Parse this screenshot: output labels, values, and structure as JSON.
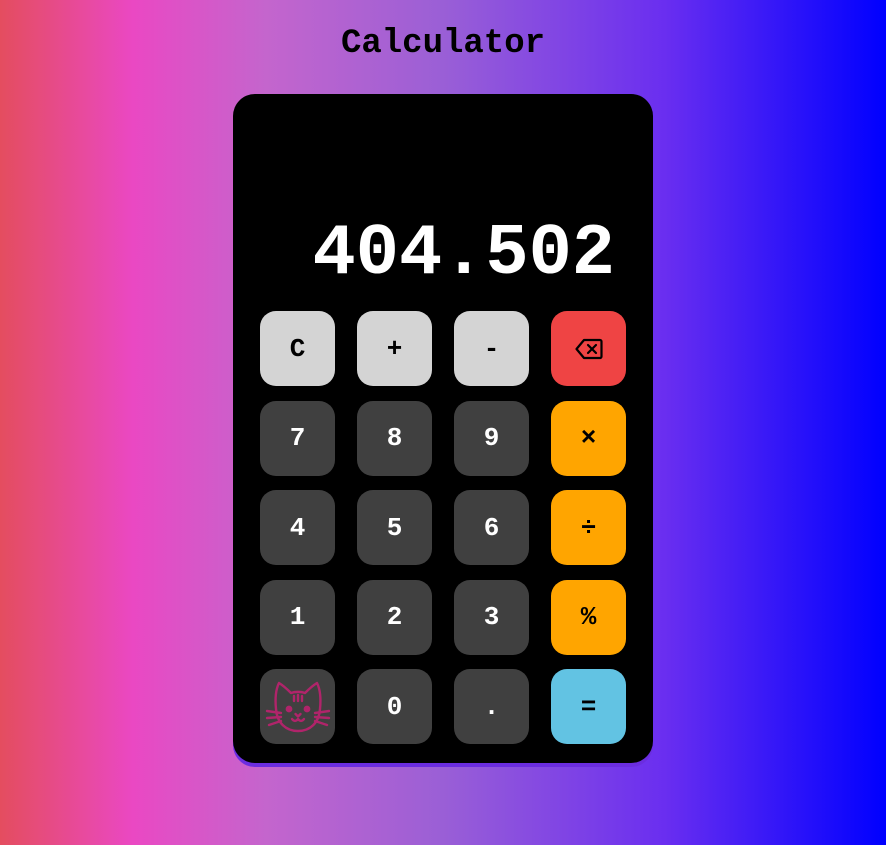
{
  "header": {
    "title": "Calculator"
  },
  "display": {
    "value": "404.502"
  },
  "keys": {
    "clear": "C",
    "plus": "+",
    "minus": "-",
    "backspace_icon": "backspace-icon",
    "seven": "7",
    "eight": "8",
    "nine": "9",
    "multiply": "×",
    "four": "4",
    "five": "5",
    "six": "6",
    "divide": "÷",
    "one": "1",
    "two": "2",
    "three": "3",
    "percent": "%",
    "cat_icon": "cat-icon",
    "zero": "0",
    "decimal": ".",
    "equals": "="
  },
  "colors": {
    "function_key": "#d4d4d4",
    "digit_key": "#404040",
    "operator_key": "#ffa500",
    "backspace_key": "#ef4444",
    "equals_key": "#62c3e3",
    "cat_icon": "#b0246a"
  }
}
